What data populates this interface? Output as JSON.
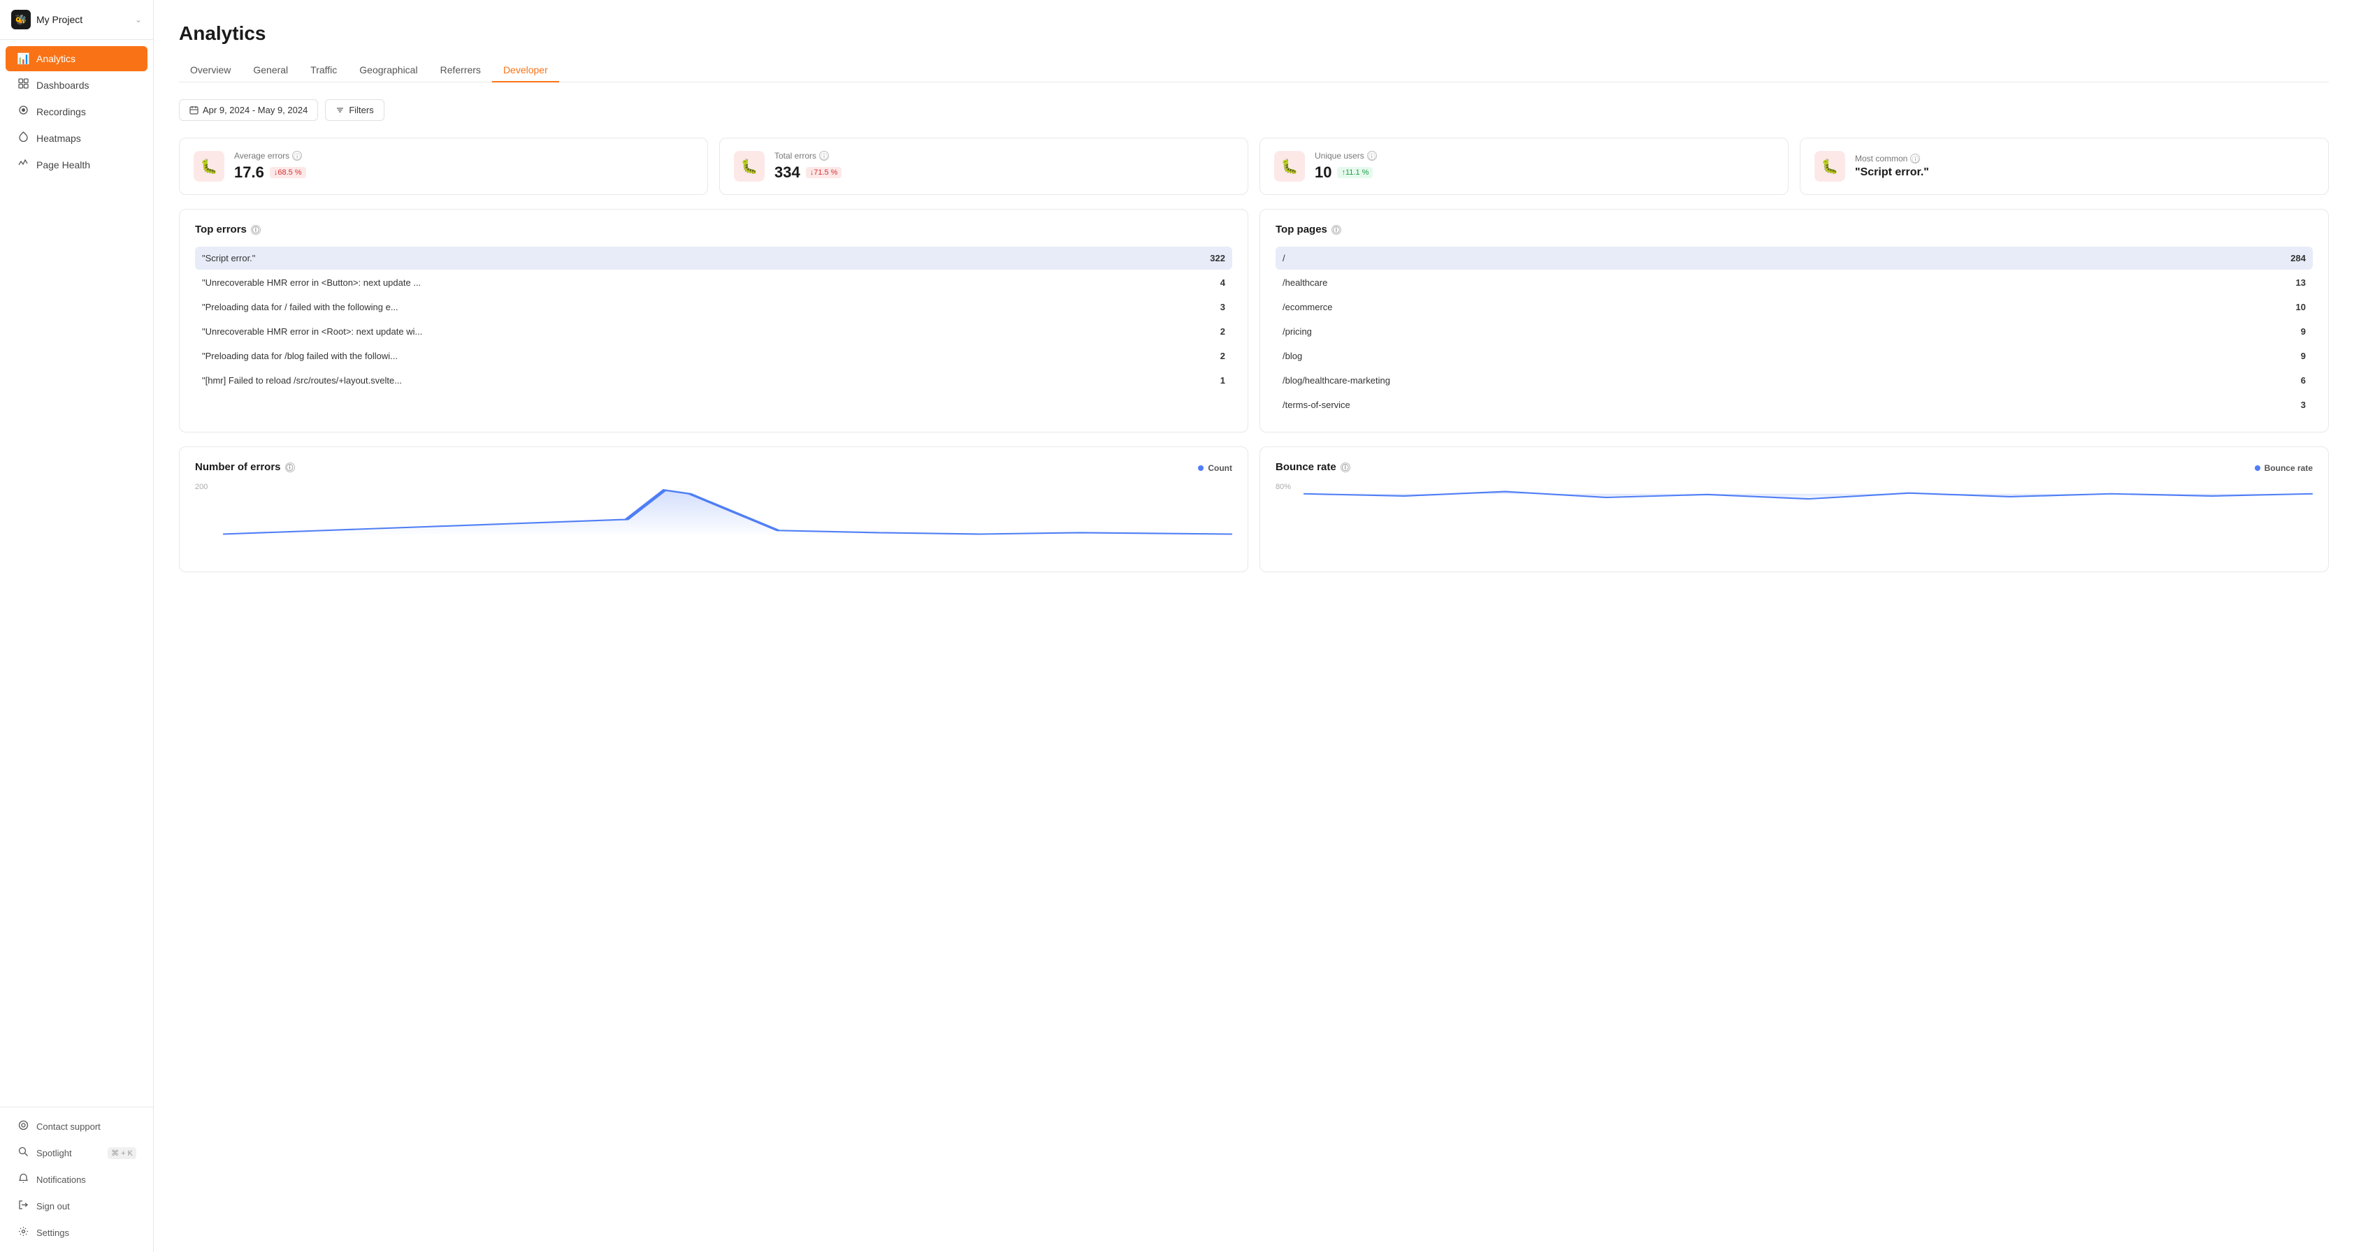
{
  "app": {
    "project_name": "My Project",
    "logo_icon": "🐝"
  },
  "sidebar": {
    "nav_items": [
      {
        "id": "analytics",
        "label": "Analytics",
        "icon": "📊",
        "active": true
      },
      {
        "id": "dashboards",
        "label": "Dashboards",
        "icon": "⊞"
      },
      {
        "id": "recordings",
        "label": "Recordings",
        "icon": "⏺"
      },
      {
        "id": "heatmaps",
        "label": "Heatmaps",
        "icon": "🔥"
      },
      {
        "id": "page-health",
        "label": "Page Health",
        "icon": "〜"
      }
    ],
    "bottom_items": [
      {
        "id": "contact-support",
        "label": "Contact support",
        "icon": "◎"
      },
      {
        "id": "spotlight",
        "label": "Spotlight",
        "icon": "🔍",
        "shortcut": "⌘ + K"
      },
      {
        "id": "notifications",
        "label": "Notifications",
        "icon": "🔔"
      },
      {
        "id": "sign-out",
        "label": "Sign out",
        "icon": "↩"
      },
      {
        "id": "settings",
        "label": "Settings",
        "icon": "⚙"
      }
    ]
  },
  "page": {
    "title": "Analytics",
    "tabs": [
      {
        "id": "overview",
        "label": "Overview"
      },
      {
        "id": "general",
        "label": "General"
      },
      {
        "id": "traffic",
        "label": "Traffic"
      },
      {
        "id": "geographical",
        "label": "Geographical"
      },
      {
        "id": "referrers",
        "label": "Referrers"
      },
      {
        "id": "developer",
        "label": "Developer",
        "active": true
      }
    ],
    "date_range": "Apr 9, 2024 - May 9, 2024",
    "filters_label": "Filters"
  },
  "stats": [
    {
      "id": "avg-errors",
      "label": "Average errors",
      "value": "17.6",
      "badge": "↓68.5 %",
      "badge_type": "down"
    },
    {
      "id": "total-errors",
      "label": "Total errors",
      "value": "334",
      "badge": "↓71.5 %",
      "badge_type": "down"
    },
    {
      "id": "unique-users",
      "label": "Unique users",
      "value": "10",
      "badge": "↑11.1 %",
      "badge_type": "up"
    },
    {
      "id": "most-common",
      "label": "Most common",
      "value": "\"Script error.\"",
      "badge": null
    }
  ],
  "top_errors": {
    "title": "Top errors",
    "rows": [
      {
        "label": "\"Script error.\"",
        "count": "322",
        "highlight": true
      },
      {
        "label": "\"Unrecoverable HMR error in <Button>: next update ...",
        "count": "4",
        "highlight": false
      },
      {
        "label": "\"Preloading data for / failed with the following e...",
        "count": "3",
        "highlight": false
      },
      {
        "label": "\"Unrecoverable HMR error in <Root>: next update wi...",
        "count": "2",
        "highlight": false
      },
      {
        "label": "\"Preloading data for /blog failed with the followi...",
        "count": "2",
        "highlight": false
      },
      {
        "label": "\"[hmr] Failed to reload /src/routes/+layout.svelte...",
        "count": "1",
        "highlight": false
      }
    ]
  },
  "top_pages": {
    "title": "Top pages",
    "rows": [
      {
        "label": "/",
        "count": "284",
        "highlight": true
      },
      {
        "label": "/healthcare",
        "count": "13",
        "highlight": false
      },
      {
        "label": "/ecommerce",
        "count": "10",
        "highlight": false
      },
      {
        "label": "/pricing",
        "count": "9",
        "highlight": false
      },
      {
        "label": "/blog",
        "count": "9",
        "highlight": false
      },
      {
        "label": "/blog/healthcare-marketing",
        "count": "6",
        "highlight": false
      },
      {
        "label": "/terms-of-service",
        "count": "3",
        "highlight": false
      }
    ]
  },
  "number_of_errors_chart": {
    "title": "Number of errors",
    "legend_label": "Count",
    "y_labels": [
      "200",
      ""
    ],
    "accent_color": "#4f7ef5"
  },
  "bounce_rate_chart": {
    "title": "Bounce rate",
    "legend_label": "Bounce rate",
    "y_labels": [
      "80%",
      ""
    ],
    "accent_color": "#4f7ef5"
  }
}
